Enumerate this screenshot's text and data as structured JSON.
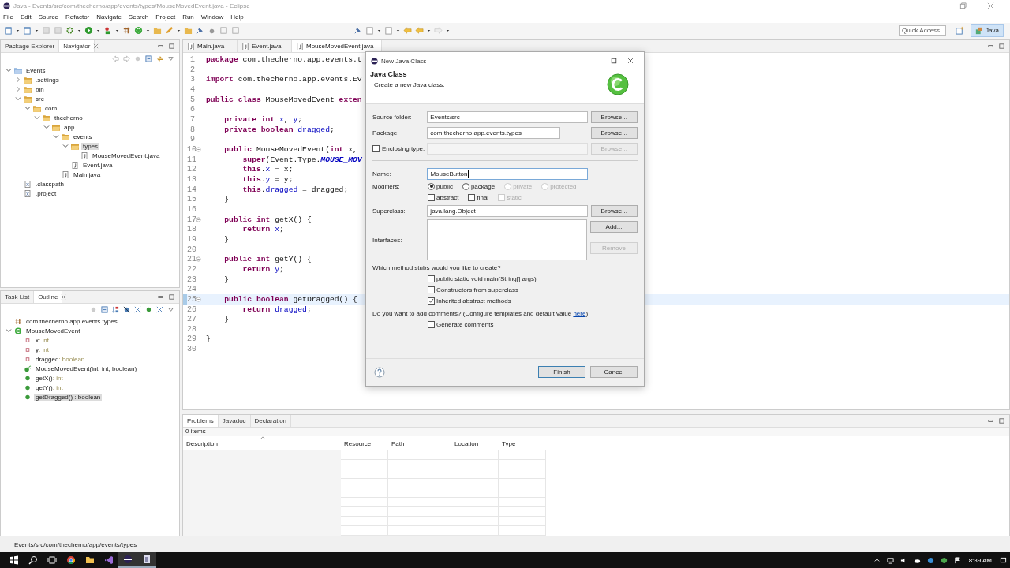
{
  "window": {
    "title": "Java - Events/src/com/thecherno/app/events/types/MouseMovedEvent.java - Eclipse"
  },
  "menu": [
    "File",
    "Edit",
    "Source",
    "Refactor",
    "Navigate",
    "Search",
    "Project",
    "Run",
    "Window",
    "Help"
  ],
  "quick_access": {
    "placeholder": "Quick Access"
  },
  "perspectives": [
    {
      "label": "Java",
      "selected": true
    }
  ],
  "navigator": {
    "tabs": [
      {
        "label": "Package Explorer",
        "selected": false
      },
      {
        "label": "Navigator",
        "selected": true
      }
    ],
    "tree": [
      {
        "label": "Events",
        "kind": "project",
        "expanded": true,
        "selected": false,
        "children": [
          {
            "label": ".settings",
            "kind": "folder",
            "expanded": false,
            "selected": false
          },
          {
            "label": "bin",
            "kind": "folder",
            "expanded": false,
            "selected": false
          },
          {
            "label": "src",
            "kind": "folder",
            "expanded": true,
            "selected": false,
            "children": [
              {
                "label": "com",
                "kind": "folder",
                "expanded": true,
                "selected": false,
                "children": [
                  {
                    "label": "thecherno",
                    "kind": "folder",
                    "expanded": true,
                    "selected": false,
                    "children": [
                      {
                        "label": "app",
                        "kind": "folder",
                        "expanded": true,
                        "selected": false,
                        "children": [
                          {
                            "label": "events",
                            "kind": "folder",
                            "expanded": true,
                            "selected": false,
                            "children": [
                              {
                                "label": "types",
                                "kind": "folder",
                                "expanded": true,
                                "selected": true,
                                "children": [
                                  {
                                    "label": "MouseMovedEvent.java",
                                    "kind": "java",
                                    "selected": false
                                  }
                                ]
                              },
                              {
                                "label": "Event.java",
                                "kind": "java",
                                "selected": false
                              }
                            ]
                          },
                          {
                            "label": "Main.java",
                            "kind": "java",
                            "selected": false
                          }
                        ]
                      }
                    ]
                  }
                ]
              }
            ]
          },
          {
            "label": ".classpath",
            "kind": "xml",
            "selected": false
          },
          {
            "label": ".project",
            "kind": "xml",
            "selected": false
          }
        ]
      }
    ]
  },
  "outline": {
    "tabs": [
      {
        "label": "Task List",
        "selected": false
      },
      {
        "label": "Outline",
        "selected": true
      }
    ],
    "items": [
      {
        "name": "com.thecherno.app.events.types",
        "kind": "package",
        "selected": false
      },
      {
        "name": "MouseMovedEvent",
        "kind": "class",
        "expanded": true,
        "selected": false,
        "children": [
          {
            "name": "x",
            "type": ": int",
            "kind": "field",
            "selected": false
          },
          {
            "name": "y",
            "type": ": int",
            "kind": "field",
            "selected": false
          },
          {
            "name": "dragged",
            "type": ": boolean",
            "kind": "field",
            "selected": false
          },
          {
            "name": "MouseMovedEvent(int, int, boolean)",
            "kind": "constructor",
            "selected": false
          },
          {
            "name": "getX()",
            "type": ": int",
            "kind": "method",
            "selected": false
          },
          {
            "name": "getY()",
            "type": ": int",
            "kind": "method",
            "selected": false
          },
          {
            "name": "getDragged() : boolean",
            "kind": "method",
            "selected": true
          }
        ]
      }
    ]
  },
  "editor": {
    "tabs": [
      {
        "label": "Main.java",
        "selected": false
      },
      {
        "label": "Event.java",
        "selected": false
      },
      {
        "label": "MouseMovedEvent.java",
        "selected": true
      }
    ],
    "lines": [
      {
        "n": "1",
        "tokens": [
          {
            "t": "package",
            "kind": "kw"
          },
          {
            "t": " com.thecherno.app.events.t",
            "kind": "plain"
          }
        ]
      },
      {
        "n": "2"
      },
      {
        "n": "3",
        "tokens": [
          {
            "t": "import",
            "kind": "kw"
          },
          {
            "t": " com.thecherno.app.events.Ev",
            "kind": "plain"
          }
        ]
      },
      {
        "n": "4"
      },
      {
        "n": "5",
        "tokens": [
          {
            "t": "public class",
            "kind": "kw"
          },
          {
            "t": " MouseMovedEvent ",
            "kind": "plain"
          },
          {
            "t": "exten",
            "kind": "kw"
          }
        ]
      },
      {
        "n": "6"
      },
      {
        "n": "7",
        "tokens": [
          {
            "t": "    private int ",
            "kind": "kw"
          },
          {
            "t": "x",
            "kind": "field"
          },
          {
            "t": ", ",
            "kind": "plain"
          },
          {
            "t": "y",
            "kind": "field"
          },
          {
            "t": ";",
            "kind": "plain"
          }
        ]
      },
      {
        "n": "8",
        "tokens": [
          {
            "t": "    private boolean ",
            "kind": "kw"
          },
          {
            "t": "dragged",
            "kind": "field"
          },
          {
            "t": ";",
            "kind": "plain"
          }
        ]
      },
      {
        "n": "9"
      },
      {
        "n": "10",
        "fold": true,
        "tokens": [
          {
            "t": "    public",
            "kind": "kw"
          },
          {
            "t": " MouseMovedEvent(",
            "kind": "plain"
          },
          {
            "t": "int",
            "kind": "kw"
          },
          {
            "t": " x,",
            "kind": "plain"
          }
        ]
      },
      {
        "n": "11",
        "tokens": [
          {
            "t": "        super",
            "kind": "kw"
          },
          {
            "t": "(Event.Type.",
            "kind": "plain"
          },
          {
            "t": "MOUSE_MOV",
            "kind": "const"
          }
        ]
      },
      {
        "n": "12",
        "tokens": [
          {
            "t": "        this",
            "kind": "kw"
          },
          {
            "t": ".",
            "kind": "plain"
          },
          {
            "t": "x",
            "kind": "field"
          },
          {
            "t": " = x;",
            "kind": "plain"
          }
        ]
      },
      {
        "n": "13",
        "tokens": [
          {
            "t": "        this",
            "kind": "kw"
          },
          {
            "t": ".",
            "kind": "plain"
          },
          {
            "t": "y",
            "kind": "field"
          },
          {
            "t": " = y;",
            "kind": "plain"
          }
        ]
      },
      {
        "n": "14",
        "tokens": [
          {
            "t": "        this",
            "kind": "kw"
          },
          {
            "t": ".",
            "kind": "plain"
          },
          {
            "t": "dragged",
            "kind": "field"
          },
          {
            "t": " = dragged;",
            "kind": "plain"
          }
        ]
      },
      {
        "n": "15",
        "tokens": [
          {
            "t": "    }",
            "kind": "plain"
          }
        ]
      },
      {
        "n": "16"
      },
      {
        "n": "17",
        "fold": true,
        "tokens": [
          {
            "t": "    public int",
            "kind": "kw"
          },
          {
            "t": " getX() {",
            "kind": "plain"
          }
        ]
      },
      {
        "n": "18",
        "tokens": [
          {
            "t": "        return ",
            "kind": "kw"
          },
          {
            "t": "x",
            "kind": "field"
          },
          {
            "t": ";",
            "kind": "plain"
          }
        ]
      },
      {
        "n": "19",
        "tokens": [
          {
            "t": "    }",
            "kind": "plain"
          }
        ]
      },
      {
        "n": "20"
      },
      {
        "n": "21",
        "fold": true,
        "tokens": [
          {
            "t": "    public int",
            "kind": "kw"
          },
          {
            "t": " getY() {",
            "kind": "plain"
          }
        ]
      },
      {
        "n": "22",
        "tokens": [
          {
            "t": "        return ",
            "kind": "kw"
          },
          {
            "t": "y",
            "kind": "field"
          },
          {
            "t": ";",
            "kind": "plain"
          }
        ]
      },
      {
        "n": "23",
        "tokens": [
          {
            "t": "    }",
            "kind": "plain"
          }
        ]
      },
      {
        "n": "24"
      },
      {
        "n": "25",
        "fold": true,
        "current": true,
        "tokens": [
          {
            "t": "    public boolean",
            "kind": "kw"
          },
          {
            "t": " getDragged() {",
            "kind": "plain"
          }
        ]
      },
      {
        "n": "26",
        "tokens": [
          {
            "t": "        return ",
            "kind": "kw"
          },
          {
            "t": "dragged",
            "kind": "field"
          },
          {
            "t": ";",
            "kind": "plain"
          }
        ]
      },
      {
        "n": "27",
        "tokens": [
          {
            "t": "    }",
            "kind": "plain"
          }
        ]
      },
      {
        "n": "28"
      },
      {
        "n": "29",
        "tokens": [
          {
            "t": "}",
            "kind": "plain"
          }
        ]
      },
      {
        "n": "30"
      }
    ]
  },
  "dialog": {
    "title": "New Java Class",
    "heading": "Java Class",
    "description": "Create a new Java class.",
    "source_folder": {
      "label": "Source folder:",
      "value": "Events/src",
      "button": "Browse..."
    },
    "package": {
      "label": "Package:",
      "value": "com.thecherno.app.events.types",
      "button": "Browse..."
    },
    "enclosing_type": {
      "label": "Enclosing type:",
      "checked": false,
      "button": "Browse..."
    },
    "name": {
      "label": "Name:",
      "value": "MouseButton",
      "focused": true
    },
    "modifiers": {
      "label": "Modifiers:",
      "radios": [
        {
          "label": "public",
          "selected": true,
          "disabled": false
        },
        {
          "label": "package",
          "selected": false,
          "disabled": false
        },
        {
          "label": "private",
          "selected": false,
          "disabled": true
        },
        {
          "label": "protected",
          "selected": false,
          "disabled": true
        }
      ],
      "checks": [
        {
          "label": "abstract",
          "checked": false,
          "disabled": false
        },
        {
          "label": "final",
          "checked": false,
          "disabled": false
        },
        {
          "label": "static",
          "checked": false,
          "disabled": true
        }
      ]
    },
    "superclass": {
      "label": "Superclass:",
      "value": "java.lang.Object",
      "button": "Browse..."
    },
    "interfaces": {
      "label": "Interfaces:",
      "buttons": [
        {
          "label": "Add...",
          "disabled": false
        },
        {
          "label": "Remove",
          "disabled": true
        }
      ]
    },
    "stubs_prompt": "Which method stubs would you like to create?",
    "stubs": [
      {
        "label": "public static void main(String[] args)",
        "checked": false
      },
      {
        "label": "Constructors from superclass",
        "checked": false
      },
      {
        "label": "Inherited abstract methods",
        "checked": true
      }
    ],
    "comments_prompt": {
      "text": "Do you want to add comments? (Configure templates and default value ",
      "link": "here",
      "after": ")"
    },
    "generate_comments": {
      "label": "Generate comments",
      "checked": false
    },
    "buttons": [
      {
        "label": "Finish",
        "default": true
      },
      {
        "label": "Cancel",
        "default": false
      }
    ]
  },
  "bottom": {
    "tabs": [
      {
        "label": "Problems",
        "selected": true
      },
      {
        "label": "Javadoc",
        "selected": false
      },
      {
        "label": "Declaration",
        "selected": false
      }
    ],
    "count": "0 items",
    "columns": [
      "Description",
      "Resource",
      "Path",
      "Location",
      "Type"
    ]
  },
  "status_bar": "Events/src/com/thecherno/app/events/types",
  "taskbar": {
    "clock": "8:39 AM"
  }
}
